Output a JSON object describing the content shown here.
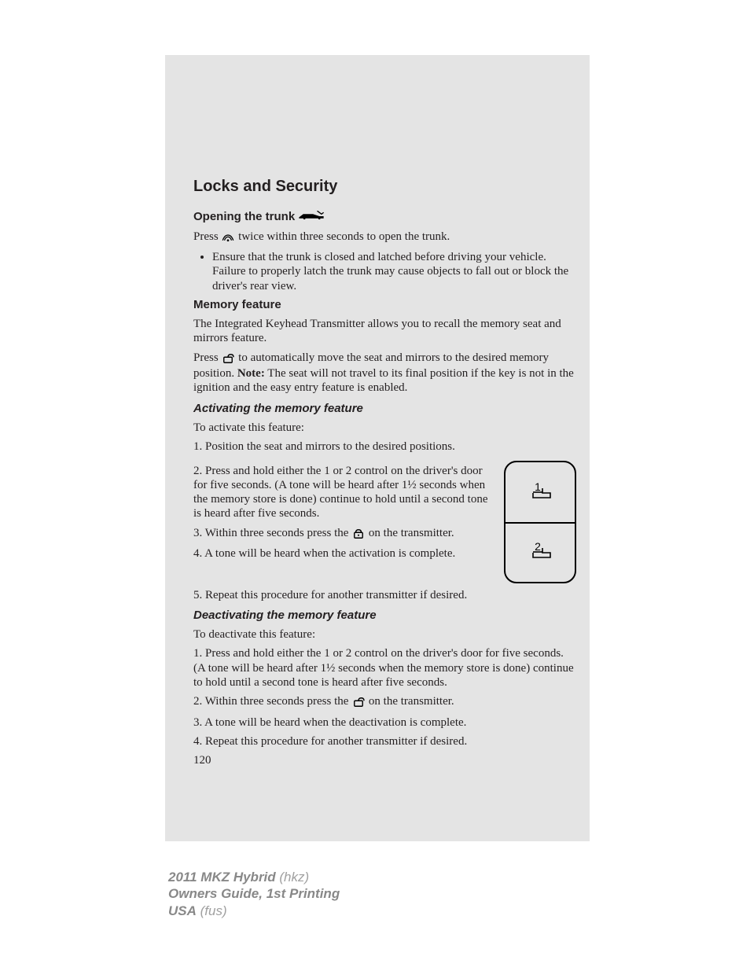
{
  "page": {
    "section_title": "Locks and Security",
    "page_number": "120"
  },
  "opening_trunk": {
    "heading": "Opening the trunk",
    "p1_a": "Press ",
    "p1_b": " twice within three seconds to open the trunk.",
    "bullet": "Ensure that the trunk is closed and latched before driving your vehicle. Failure to properly latch the trunk may cause objects to fall out or block the driver's rear view."
  },
  "memory": {
    "heading": "Memory feature",
    "p1": "The Integrated Keyhead Transmitter allows you to recall the memory seat and mirrors feature.",
    "p2_a": "Press ",
    "p2_b": " to automatically move the seat and mirrors to the desired memory position. ",
    "note_label": "Note:",
    "p2_c": " The seat will not travel to its final position if the key is not in the ignition and the easy entry feature is enabled."
  },
  "activate": {
    "heading": "Activating the memory feature",
    "intro": "To activate this feature:",
    "s1": "1. Position the seat and mirrors to the desired positions.",
    "s2": "2. Press and hold either the 1 or 2 control on the driver's door for five seconds. (A tone will be heard after 1½ seconds when the memory store is done) continue to hold until a second tone is heard after five seconds.",
    "s3_a": "3. Within three seconds press the ",
    "s3_b": " on the transmitter.",
    "s4": "4. A tone will be heard when the activation is complete.",
    "s5": "5. Repeat this procedure for another transmitter if desired.",
    "button1": "1",
    "button2": "2"
  },
  "deactivate": {
    "heading": "Deactivating the memory feature",
    "intro": "To deactivate this feature:",
    "s1": "1. Press and hold either the 1 or 2 control on the driver's door for five seconds. (A tone will be heard after 1½ seconds when the memory store is done) continue to hold until a second tone is heard after five seconds.",
    "s2_a": "2. Within three seconds press the ",
    "s2_b": " on the transmitter.",
    "s3": "3. A tone will be heard when the deactivation is complete.",
    "s4": "4. Repeat this procedure for another transmitter if desired."
  },
  "footer": {
    "model": "2011 MKZ Hybrid",
    "model_code": " (hkz)",
    "guide": "Owners Guide, 1st Printing",
    "region": "USA",
    "region_code": " (fus)"
  }
}
